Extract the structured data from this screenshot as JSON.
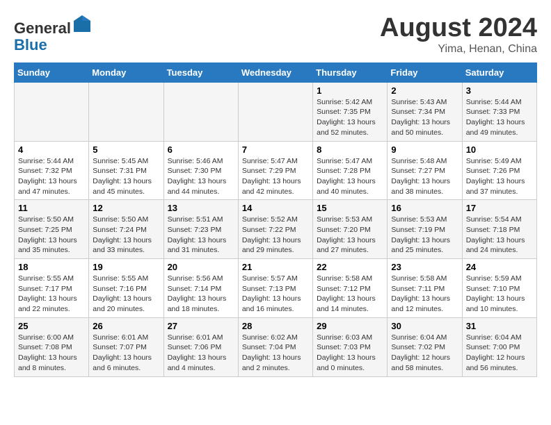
{
  "header": {
    "logo_line1": "General",
    "logo_line2": "Blue",
    "month_year": "August 2024",
    "location": "Yima, Henan, China"
  },
  "weekdays": [
    "Sunday",
    "Monday",
    "Tuesday",
    "Wednesday",
    "Thursday",
    "Friday",
    "Saturday"
  ],
  "weeks": [
    [
      {
        "day": "",
        "info": ""
      },
      {
        "day": "",
        "info": ""
      },
      {
        "day": "",
        "info": ""
      },
      {
        "day": "",
        "info": ""
      },
      {
        "day": "1",
        "info": "Sunrise: 5:42 AM\nSunset: 7:35 PM\nDaylight: 13 hours\nand 52 minutes."
      },
      {
        "day": "2",
        "info": "Sunrise: 5:43 AM\nSunset: 7:34 PM\nDaylight: 13 hours\nand 50 minutes."
      },
      {
        "day": "3",
        "info": "Sunrise: 5:44 AM\nSunset: 7:33 PM\nDaylight: 13 hours\nand 49 minutes."
      }
    ],
    [
      {
        "day": "4",
        "info": "Sunrise: 5:44 AM\nSunset: 7:32 PM\nDaylight: 13 hours\nand 47 minutes."
      },
      {
        "day": "5",
        "info": "Sunrise: 5:45 AM\nSunset: 7:31 PM\nDaylight: 13 hours\nand 45 minutes."
      },
      {
        "day": "6",
        "info": "Sunrise: 5:46 AM\nSunset: 7:30 PM\nDaylight: 13 hours\nand 44 minutes."
      },
      {
        "day": "7",
        "info": "Sunrise: 5:47 AM\nSunset: 7:29 PM\nDaylight: 13 hours\nand 42 minutes."
      },
      {
        "day": "8",
        "info": "Sunrise: 5:47 AM\nSunset: 7:28 PM\nDaylight: 13 hours\nand 40 minutes."
      },
      {
        "day": "9",
        "info": "Sunrise: 5:48 AM\nSunset: 7:27 PM\nDaylight: 13 hours\nand 38 minutes."
      },
      {
        "day": "10",
        "info": "Sunrise: 5:49 AM\nSunset: 7:26 PM\nDaylight: 13 hours\nand 37 minutes."
      }
    ],
    [
      {
        "day": "11",
        "info": "Sunrise: 5:50 AM\nSunset: 7:25 PM\nDaylight: 13 hours\nand 35 minutes."
      },
      {
        "day": "12",
        "info": "Sunrise: 5:50 AM\nSunset: 7:24 PM\nDaylight: 13 hours\nand 33 minutes."
      },
      {
        "day": "13",
        "info": "Sunrise: 5:51 AM\nSunset: 7:23 PM\nDaylight: 13 hours\nand 31 minutes."
      },
      {
        "day": "14",
        "info": "Sunrise: 5:52 AM\nSunset: 7:22 PM\nDaylight: 13 hours\nand 29 minutes."
      },
      {
        "day": "15",
        "info": "Sunrise: 5:53 AM\nSunset: 7:20 PM\nDaylight: 13 hours\nand 27 minutes."
      },
      {
        "day": "16",
        "info": "Sunrise: 5:53 AM\nSunset: 7:19 PM\nDaylight: 13 hours\nand 25 minutes."
      },
      {
        "day": "17",
        "info": "Sunrise: 5:54 AM\nSunset: 7:18 PM\nDaylight: 13 hours\nand 24 minutes."
      }
    ],
    [
      {
        "day": "18",
        "info": "Sunrise: 5:55 AM\nSunset: 7:17 PM\nDaylight: 13 hours\nand 22 minutes."
      },
      {
        "day": "19",
        "info": "Sunrise: 5:55 AM\nSunset: 7:16 PM\nDaylight: 13 hours\nand 20 minutes."
      },
      {
        "day": "20",
        "info": "Sunrise: 5:56 AM\nSunset: 7:14 PM\nDaylight: 13 hours\nand 18 minutes."
      },
      {
        "day": "21",
        "info": "Sunrise: 5:57 AM\nSunset: 7:13 PM\nDaylight: 13 hours\nand 16 minutes."
      },
      {
        "day": "22",
        "info": "Sunrise: 5:58 AM\nSunset: 7:12 PM\nDaylight: 13 hours\nand 14 minutes."
      },
      {
        "day": "23",
        "info": "Sunrise: 5:58 AM\nSunset: 7:11 PM\nDaylight: 13 hours\nand 12 minutes."
      },
      {
        "day": "24",
        "info": "Sunrise: 5:59 AM\nSunset: 7:10 PM\nDaylight: 13 hours\nand 10 minutes."
      }
    ],
    [
      {
        "day": "25",
        "info": "Sunrise: 6:00 AM\nSunset: 7:08 PM\nDaylight: 13 hours\nand 8 minutes."
      },
      {
        "day": "26",
        "info": "Sunrise: 6:01 AM\nSunset: 7:07 PM\nDaylight: 13 hours\nand 6 minutes."
      },
      {
        "day": "27",
        "info": "Sunrise: 6:01 AM\nSunset: 7:06 PM\nDaylight: 13 hours\nand 4 minutes."
      },
      {
        "day": "28",
        "info": "Sunrise: 6:02 AM\nSunset: 7:04 PM\nDaylight: 13 hours\nand 2 minutes."
      },
      {
        "day": "29",
        "info": "Sunrise: 6:03 AM\nSunset: 7:03 PM\nDaylight: 13 hours\nand 0 minutes."
      },
      {
        "day": "30",
        "info": "Sunrise: 6:04 AM\nSunset: 7:02 PM\nDaylight: 12 hours\nand 58 minutes."
      },
      {
        "day": "31",
        "info": "Sunrise: 6:04 AM\nSunset: 7:00 PM\nDaylight: 12 hours\nand 56 minutes."
      }
    ]
  ]
}
